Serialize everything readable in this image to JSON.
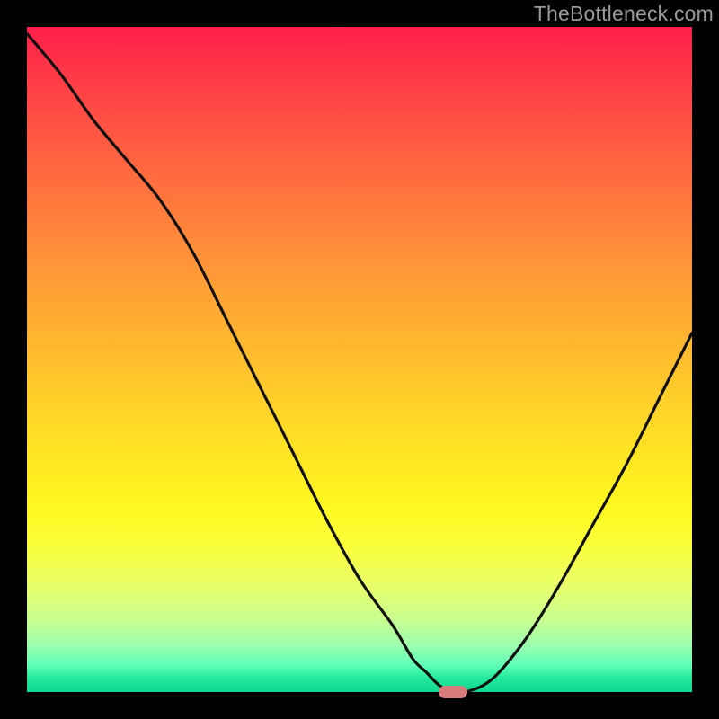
{
  "watermark": "TheBottleneck.com",
  "colors": {
    "frame": "#000000",
    "curve_stroke": "#111111",
    "marker_fill": "#d97b7d",
    "gradient_top": "#ff1f4a",
    "gradient_bottom": "#0fd88f"
  },
  "chart_data": {
    "type": "line",
    "title": "",
    "xlabel": "",
    "ylabel": "",
    "xlim": [
      0,
      100
    ],
    "ylim": [
      0,
      100
    ],
    "grid": false,
    "legend": false,
    "series": [
      {
        "name": "bottleneck-curve",
        "x": [
          0,
          5,
          10,
          15,
          20,
          25,
          30,
          35,
          40,
          45,
          50,
          55,
          58,
          60,
          62,
          64,
          66,
          70,
          75,
          80,
          85,
          90,
          95,
          100
        ],
        "y": [
          99,
          93,
          86,
          80,
          74,
          66,
          56,
          46,
          36,
          26,
          17,
          10,
          5,
          3,
          1,
          0,
          0,
          2,
          8,
          16,
          25,
          34,
          44,
          54
        ]
      }
    ],
    "marker": {
      "x": 64,
      "y": 0
    }
  }
}
